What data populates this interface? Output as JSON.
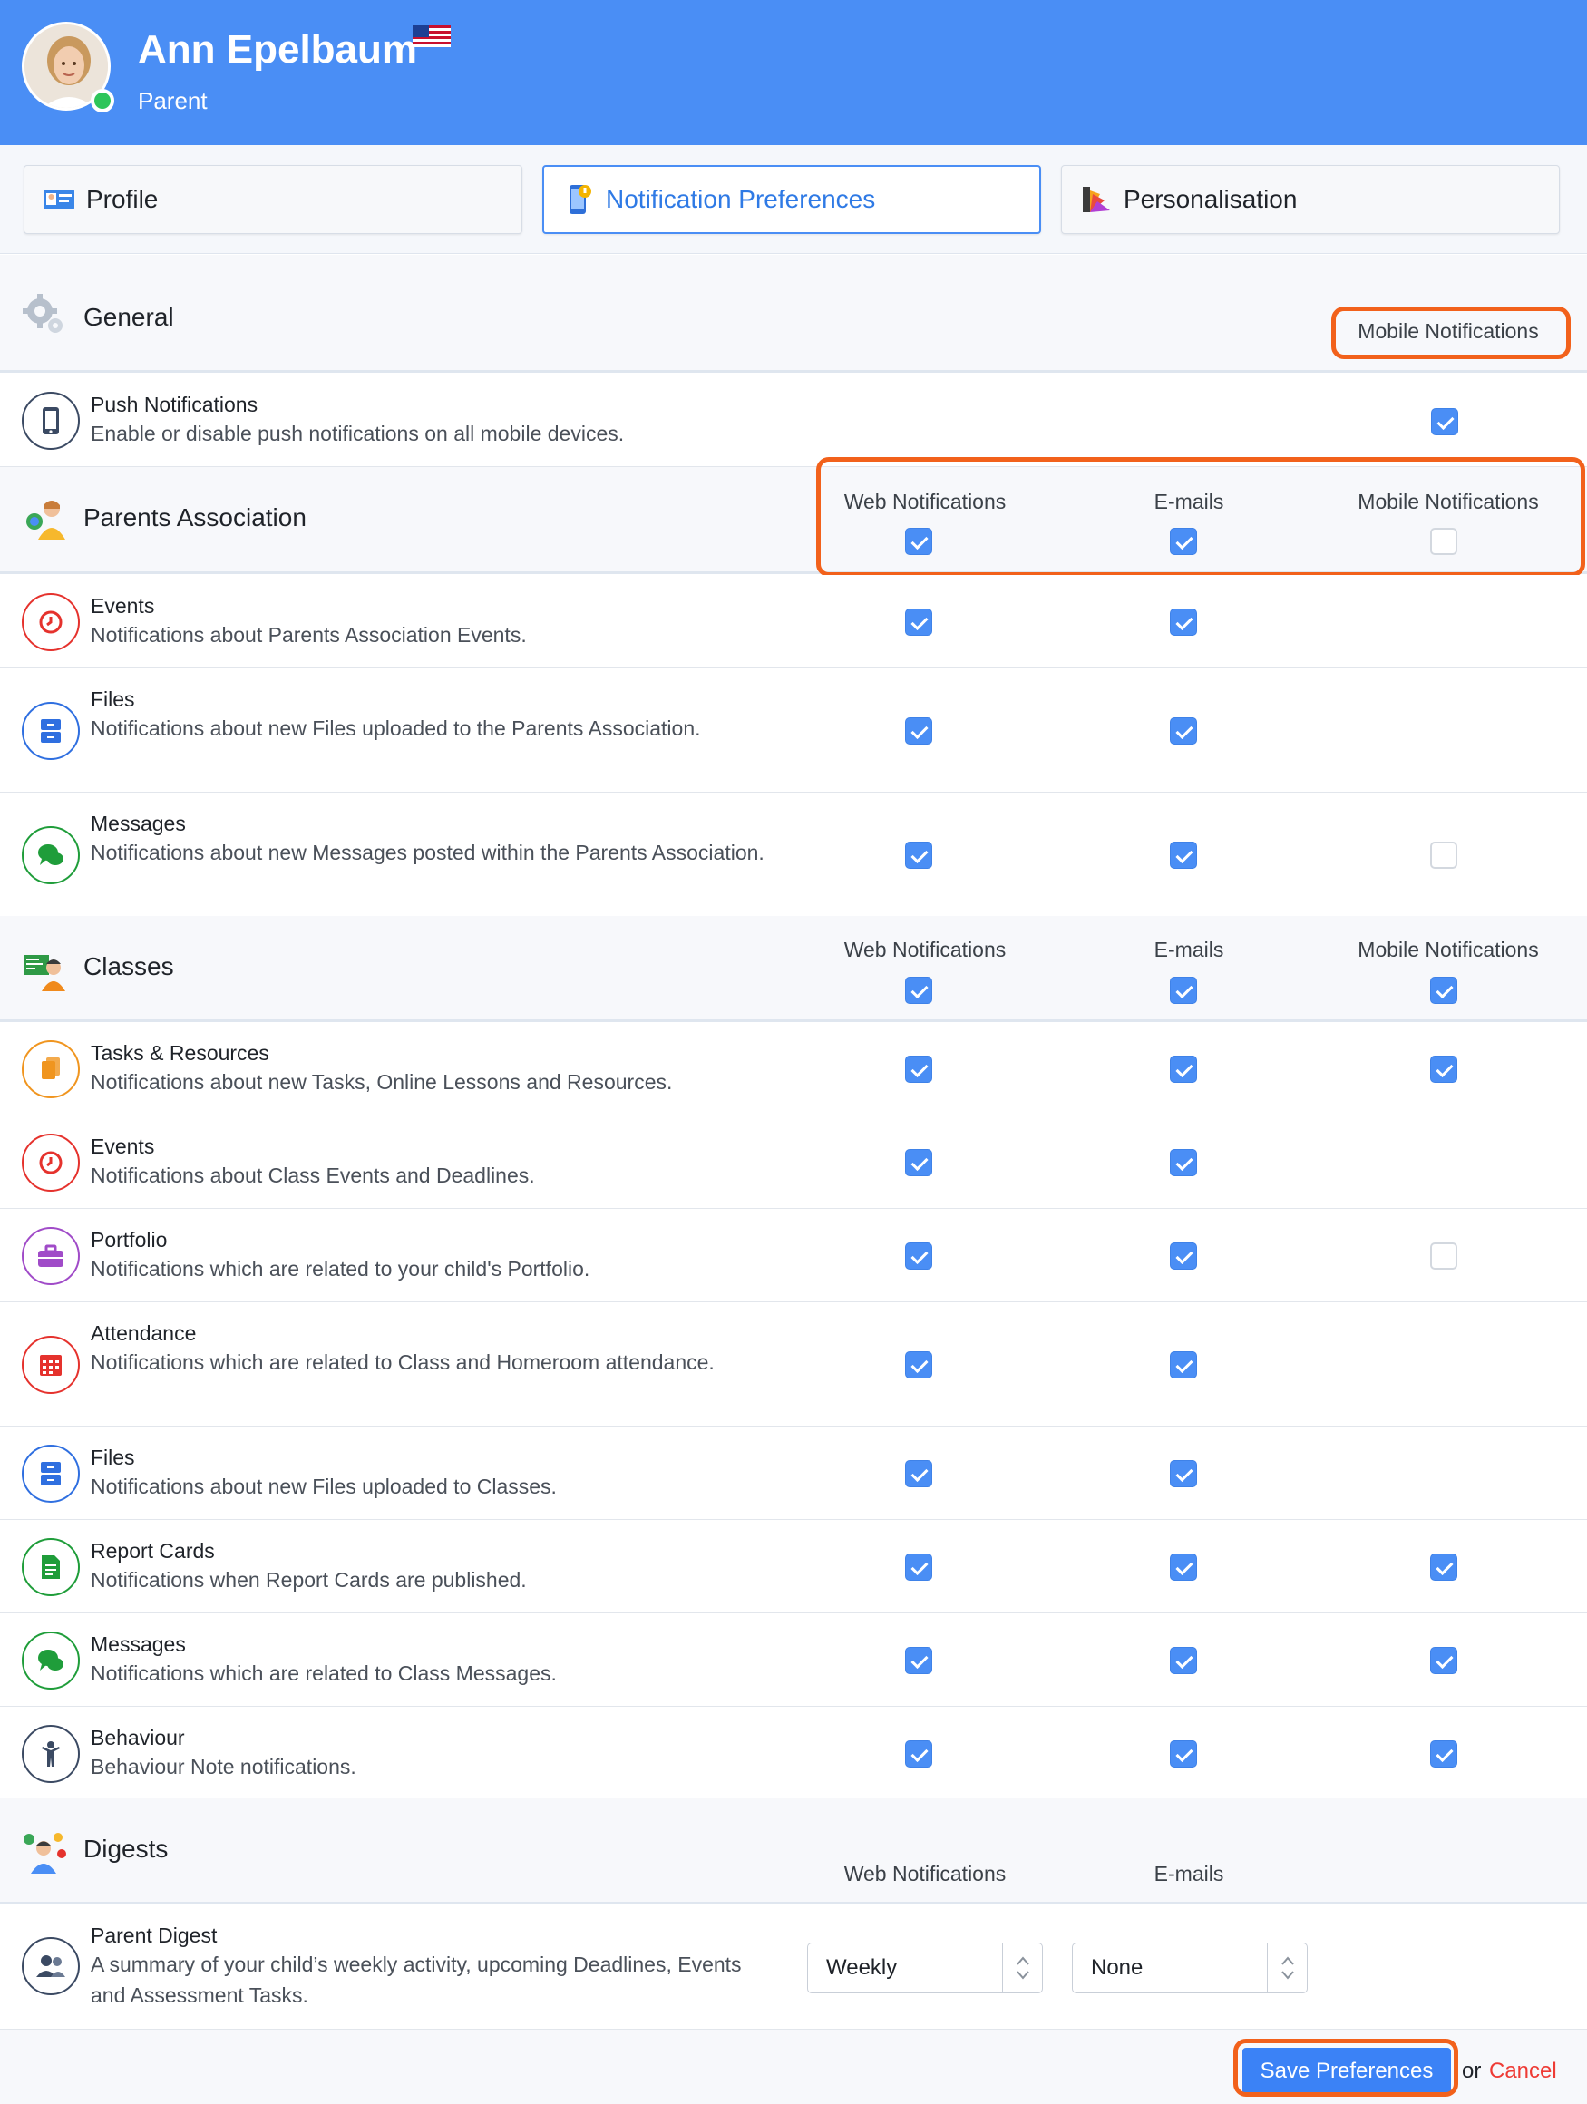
{
  "user": {
    "name": "Ann Epelbaum",
    "role": "Parent"
  },
  "tabs": [
    {
      "label": "Profile",
      "icon": "id-card-icon"
    },
    {
      "label": "Notification Preferences",
      "icon": "phone-notification-icon",
      "active": true
    },
    {
      "label": "Personalisation",
      "icon": "palette-icon"
    }
  ],
  "general": {
    "title": "General",
    "col_mobile": "Mobile Notifications",
    "push": {
      "title": "Push Notifications",
      "desc": "Enable or disable push notifications on all mobile devices.",
      "mobile": true
    }
  },
  "pa": {
    "title": "Parents Association",
    "col_web": "Web Notifications",
    "col_email": "E-mails",
    "col_mobile": "Mobile Notifications",
    "master": {
      "web": true,
      "email": true,
      "mobile": false
    },
    "rows": [
      {
        "title": "Events",
        "desc": "Notifications about Parents Association Events.",
        "icon": "clock-icon",
        "color": "#e5322d",
        "web": true,
        "email": true,
        "mobile": null
      },
      {
        "title": "Files",
        "desc": "Notifications about new Files uploaded to the Parents Association.",
        "icon": "files-icon",
        "color": "#2f6fe0",
        "web": true,
        "email": true,
        "mobile": null
      },
      {
        "title": "Messages",
        "desc": "Notifications about new Messages posted within the Parents Association.",
        "icon": "chat-icon",
        "color": "#1f9d3a",
        "web": true,
        "email": true,
        "mobile": false
      }
    ]
  },
  "classes": {
    "title": "Classes",
    "col_web": "Web Notifications",
    "col_email": "E-mails",
    "col_mobile": "Mobile Notifications",
    "master": {
      "web": true,
      "email": true,
      "mobile": true
    },
    "rows": [
      {
        "title": "Tasks & Resources",
        "desc": "Notifications about new Tasks, Online Lessons and Resources.",
        "icon": "copy-icon",
        "color": "#f0951f",
        "web": true,
        "email": true,
        "mobile": true
      },
      {
        "title": "Events",
        "desc": "Notifications about Class Events and Deadlines.",
        "icon": "clock-icon",
        "color": "#e5322d",
        "web": true,
        "email": true,
        "mobile": null
      },
      {
        "title": "Portfolio",
        "desc": "Notifications which are related to your child's Portfolio.",
        "icon": "briefcase-icon",
        "color": "#a04bc8",
        "web": true,
        "email": true,
        "mobile": false
      },
      {
        "title": "Attendance",
        "desc": "Notifications which are related to Class and Homeroom attendance.",
        "icon": "calendar-icon",
        "color": "#e5322d",
        "web": true,
        "email": true,
        "mobile": null
      },
      {
        "title": "Files",
        "desc": "Notifications about new Files uploaded to Classes.",
        "icon": "files-icon",
        "color": "#2f6fe0",
        "web": true,
        "email": true,
        "mobile": null
      },
      {
        "title": "Report Cards",
        "desc": "Notifications when Report Cards are published.",
        "icon": "report-icon",
        "color": "#1f9d3a",
        "web": true,
        "email": true,
        "mobile": true
      },
      {
        "title": "Messages",
        "desc": "Notifications which are related to Class Messages.",
        "icon": "chat-icon",
        "color": "#1f9d3a",
        "web": true,
        "email": true,
        "mobile": true
      },
      {
        "title": "Behaviour",
        "desc": "Behaviour Note notifications.",
        "icon": "person-icon",
        "color": "#3b4a63",
        "web": true,
        "email": true,
        "mobile": true
      }
    ]
  },
  "digests": {
    "title": "Digests",
    "col_web": "Web Notifications",
    "col_email": "E-mails",
    "parent_digest": {
      "title": "Parent Digest",
      "desc": "A summary of your child’s weekly activity, upcoming Deadlines, Events and Assessment Tasks.",
      "web_value": "Weekly",
      "email_value": "None"
    }
  },
  "footer": {
    "save_label": "Save Preferences",
    "or_text": "or",
    "cancel_label": "Cancel"
  }
}
